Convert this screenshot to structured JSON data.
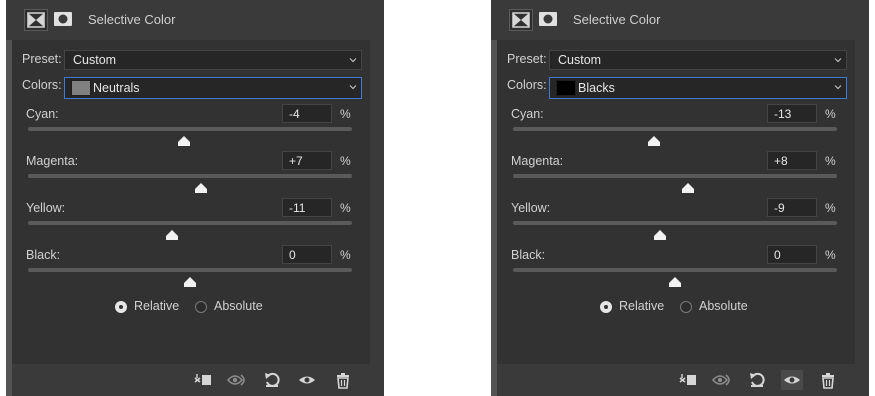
{
  "panels": [
    {
      "title": "Selective Color",
      "preset_label": "Preset:",
      "preset_value": "Custom",
      "colors_label": "Colors:",
      "colors_value": "Neutrals",
      "swatch_color": "#808080",
      "sliders": [
        {
          "label": "Cyan:",
          "value": "-4",
          "pct": "%",
          "level": -4
        },
        {
          "label": "Magenta:",
          "value": "+7",
          "pct": "%",
          "level": 7
        },
        {
          "label": "Yellow:",
          "value": "-11",
          "pct": "%",
          "level": -11
        },
        {
          "label": "Black:",
          "value": "0",
          "pct": "%",
          "level": 0
        }
      ],
      "method": {
        "relative": "Relative",
        "absolute": "Absolute",
        "selected": "relative"
      },
      "footer_icons": [
        "clip-to-layer-icon",
        "view-previous-icon",
        "reset-icon",
        "visibility-icon",
        "delete-icon"
      ],
      "active_footer_icon": ""
    },
    {
      "title": "Selective Color",
      "preset_label": "Preset:",
      "preset_value": "Custom",
      "colors_label": "Colors:",
      "colors_value": "Blacks",
      "swatch_color": "#000000",
      "sliders": [
        {
          "label": "Cyan:",
          "value": "-13",
          "pct": "%",
          "level": -13
        },
        {
          "label": "Magenta:",
          "value": "+8",
          "pct": "%",
          "level": 8
        },
        {
          "label": "Yellow:",
          "value": "-9",
          "pct": "%",
          "level": -9
        },
        {
          "label": "Black:",
          "value": "0",
          "pct": "%",
          "level": 0
        }
      ],
      "method": {
        "relative": "Relative",
        "absolute": "Absolute",
        "selected": "relative"
      },
      "footer_icons": [
        "clip-to-layer-icon",
        "view-previous-icon",
        "reset-icon",
        "visibility-icon",
        "delete-icon"
      ],
      "active_footer_icon": "visibility-icon"
    }
  ]
}
